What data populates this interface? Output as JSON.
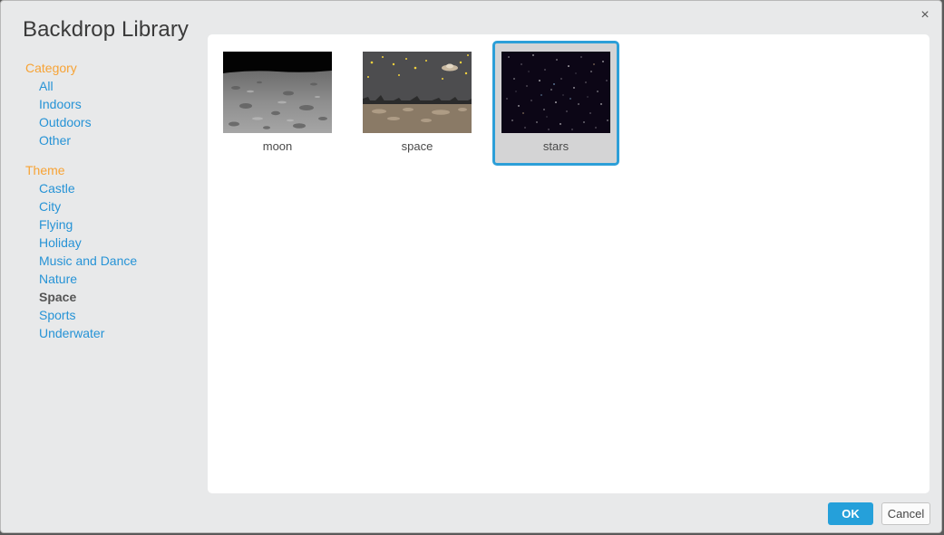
{
  "dialog": {
    "title": "Backdrop Library",
    "close_symbol": "×"
  },
  "sidebar": {
    "category": {
      "heading": "Category",
      "items": [
        "All",
        "Indoors",
        "Outdoors",
        "Other"
      ]
    },
    "theme": {
      "heading": "Theme",
      "items": [
        "Castle",
        "City",
        "Flying",
        "Holiday",
        "Music and Dance",
        "Nature",
        "Space",
        "Sports",
        "Underwater"
      ],
      "active": "Space"
    }
  },
  "backdrops": [
    {
      "label": "moon",
      "selected": false
    },
    {
      "label": "space",
      "selected": false
    },
    {
      "label": "stars",
      "selected": true
    }
  ],
  "footer": {
    "ok_label": "OK",
    "cancel_label": "Cancel"
  },
  "colors": {
    "accent_blue": "#25a0da",
    "heading_orange": "#f7a335",
    "link_blue": "#2693d6"
  }
}
